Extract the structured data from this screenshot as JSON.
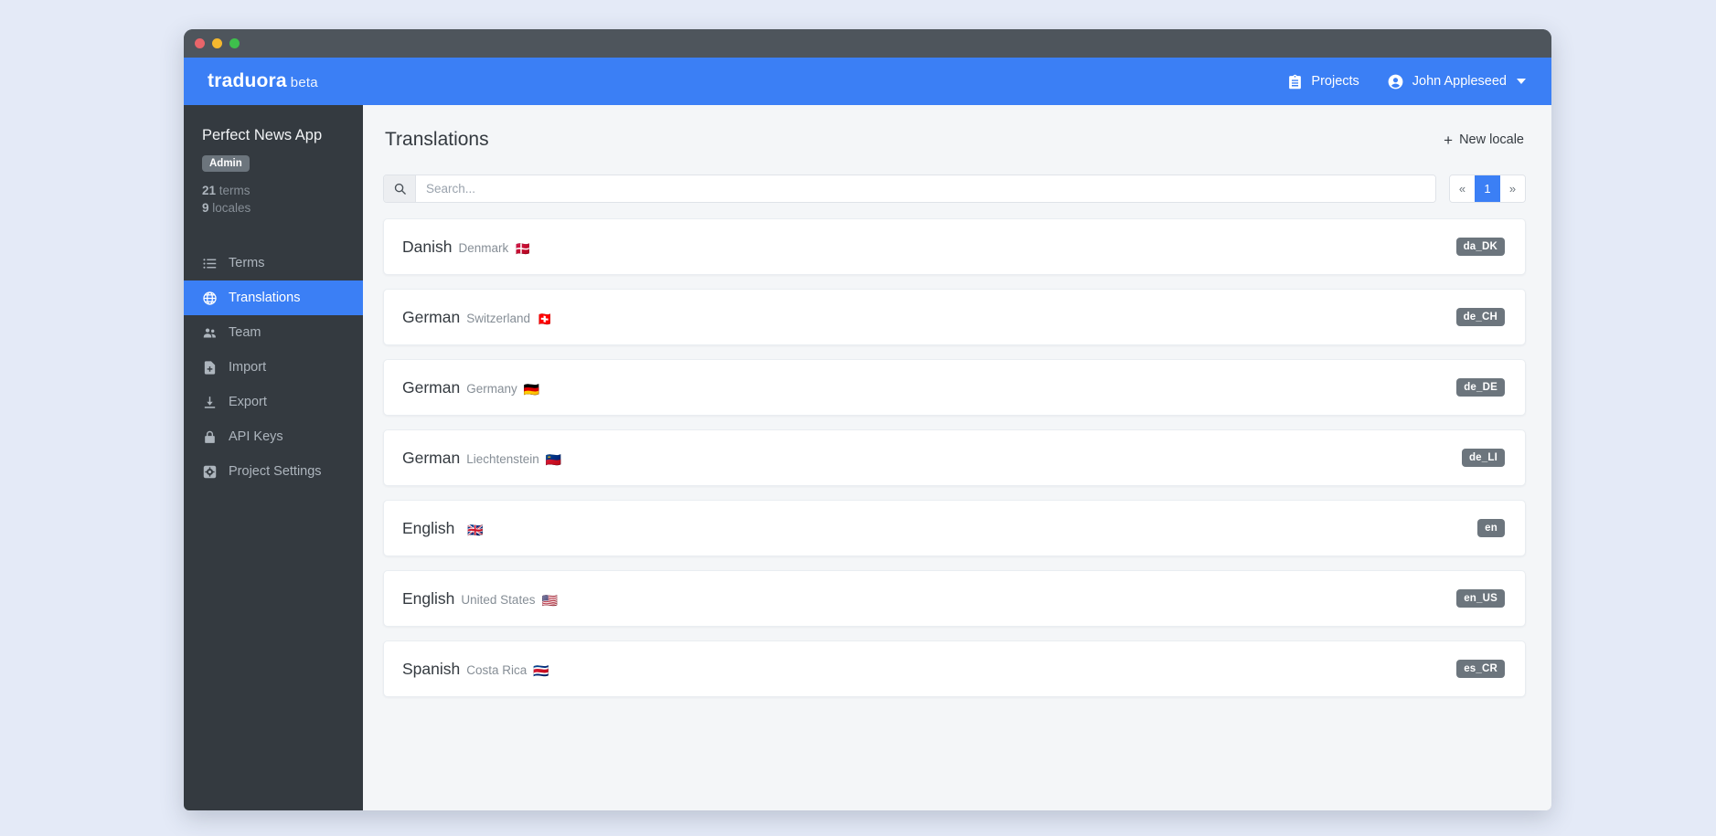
{
  "window": {
    "traffic_lights": [
      "close",
      "minimize",
      "maximize"
    ]
  },
  "topnav": {
    "brand": "traduora",
    "brand_suffix": "beta",
    "projects_label": "Projects",
    "user_name": "John Appleseed",
    "projects_icon": "clipboard-icon",
    "user_icon": "account-circle-icon",
    "caret_icon": "chevron-down-icon",
    "background_color": "#3b7ff5"
  },
  "sidebar": {
    "project_name": "Perfect News App",
    "role_badge": "Admin",
    "terms_count": "21",
    "terms_label": "terms",
    "locales_count": "9",
    "locales_label": "locales",
    "background_color": "#343a40",
    "active_color": "#3b7ff5",
    "items": [
      {
        "label": "Terms",
        "icon": "list-icon",
        "active": false
      },
      {
        "label": "Translations",
        "icon": "globe-icon",
        "active": true
      },
      {
        "label": "Team",
        "icon": "people-icon",
        "active": false
      },
      {
        "label": "Import",
        "icon": "file-import-icon",
        "active": false
      },
      {
        "label": "Export",
        "icon": "download-icon",
        "active": false
      },
      {
        "label": "API Keys",
        "icon": "lock-icon",
        "active": false
      },
      {
        "label": "Project Settings",
        "icon": "gear-icon",
        "active": false
      }
    ]
  },
  "main": {
    "title": "Translations",
    "new_locale_label": "New locale",
    "new_locale_plus": "+",
    "search": {
      "placeholder": "Search...",
      "value": "",
      "icon": "search-icon"
    },
    "pagination": {
      "first_label": "«",
      "last_label": "»",
      "current_page": "1"
    },
    "locales": [
      {
        "language": "Danish",
        "region": "Denmark",
        "flag": "🇩🇰",
        "code": "da_DK"
      },
      {
        "language": "German",
        "region": "Switzerland",
        "flag": "🇨🇭",
        "code": "de_CH"
      },
      {
        "language": "German",
        "region": "Germany",
        "flag": "🇩🇪",
        "code": "de_DE"
      },
      {
        "language": "German",
        "region": "Liechtenstein",
        "flag": "🇱🇮",
        "code": "de_LI"
      },
      {
        "language": "English",
        "region": "",
        "flag": "🇬🇧",
        "code": "en"
      },
      {
        "language": "English",
        "region": "United States",
        "flag": "🇺🇸",
        "code": "en_US"
      },
      {
        "language": "Spanish",
        "region": "Costa Rica",
        "flag": "🇨🇷",
        "code": "es_CR"
      }
    ]
  }
}
